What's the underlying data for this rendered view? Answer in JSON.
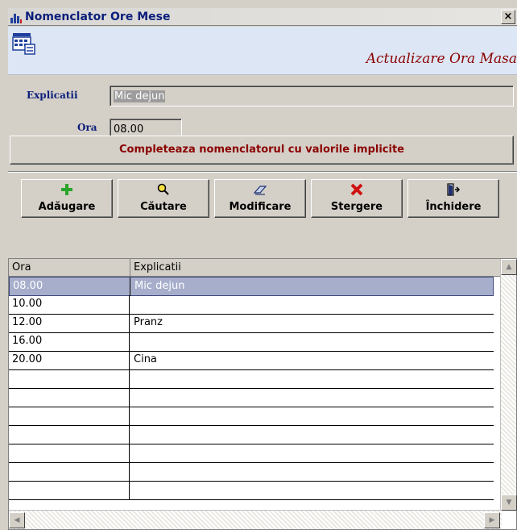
{
  "window": {
    "title": "Nomenclator Ore Mese",
    "close_glyph": "×"
  },
  "header": {
    "subtitle": "Actualizare Ora Masa",
    "icon": "table-form-icon"
  },
  "form": {
    "explicatii_label": "Explicatii",
    "explicatii_value": "Mic dejun",
    "ora_label": "Ora",
    "ora_value": "08.00"
  },
  "defaults_button": "Completeaza nomenclatorul cu valorile implicite",
  "toolbar": {
    "add": {
      "label": "Adăugare",
      "icon": "plus-icon",
      "color": "#2aa52a"
    },
    "search": {
      "label": "Căutare",
      "icon": "magnifier-icon",
      "color": "#e0c000"
    },
    "edit": {
      "label": "Modificare",
      "icon": "edit-pen-icon",
      "color": "#203070"
    },
    "delete": {
      "label": "Stergere",
      "icon": "x-icon",
      "color": "#d01010"
    },
    "close": {
      "label": "Închidere",
      "icon": "exit-door-icon",
      "color": "#203070"
    }
  },
  "grid": {
    "columns": [
      "Ora",
      "Explicatii"
    ],
    "rows": [
      {
        "ora": "08.00",
        "explicatii": "Mic dejun"
      },
      {
        "ora": "10.00",
        "explicatii": ""
      },
      {
        "ora": "12.00",
        "explicatii": "Pranz"
      },
      {
        "ora": "16.00",
        "explicatii": ""
      },
      {
        "ora": "20.00",
        "explicatii": "Cina"
      }
    ]
  },
  "colors": {
    "accent": "#8b0000",
    "label": "#0a1e7a",
    "selection": "#a6aecb"
  }
}
